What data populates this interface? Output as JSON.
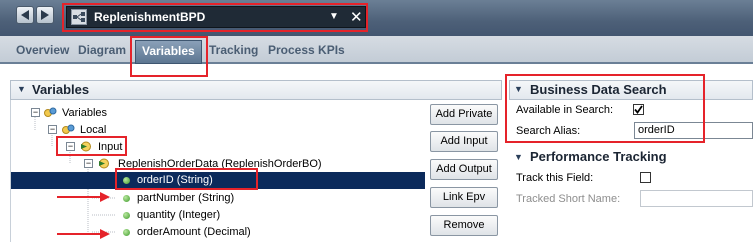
{
  "editor": {
    "bpd_name": "ReplenishmentBPD",
    "tabs": [
      "Overview",
      "Diagram",
      "Variables",
      "Tracking",
      "Process KPIs"
    ],
    "active_tab": "Variables"
  },
  "variables_panel": {
    "title": "Variables",
    "tree": {
      "root": "Variables",
      "local": "Local",
      "input": "Input",
      "order_data": "ReplenishOrderData (ReplenishOrderBO)",
      "fields": [
        "orderID (String)",
        "partNumber (String)",
        "quantity (Integer)",
        "orderAmount (Decimal)"
      ],
      "selected_field": "orderID (String)"
    },
    "buttons": [
      "Add Private",
      "Add Input",
      "Add Output",
      "Link Epv",
      "Remove"
    ]
  },
  "business_data_search": {
    "title": "Business Data Search",
    "available_label": "Available in Search:",
    "available_checked": true,
    "alias_label": "Search Alias:",
    "alias_value": "orderID"
  },
  "performance_tracking": {
    "title": "Performance Tracking",
    "track_label": "Track this Field:",
    "track_checked": false,
    "short_name_label": "Tracked Short Name:",
    "short_name_value": ""
  },
  "colors": {
    "annotation_red": "#e5232a",
    "selection_navy": "#0b2a5b",
    "tab_active": "#5d7691"
  }
}
